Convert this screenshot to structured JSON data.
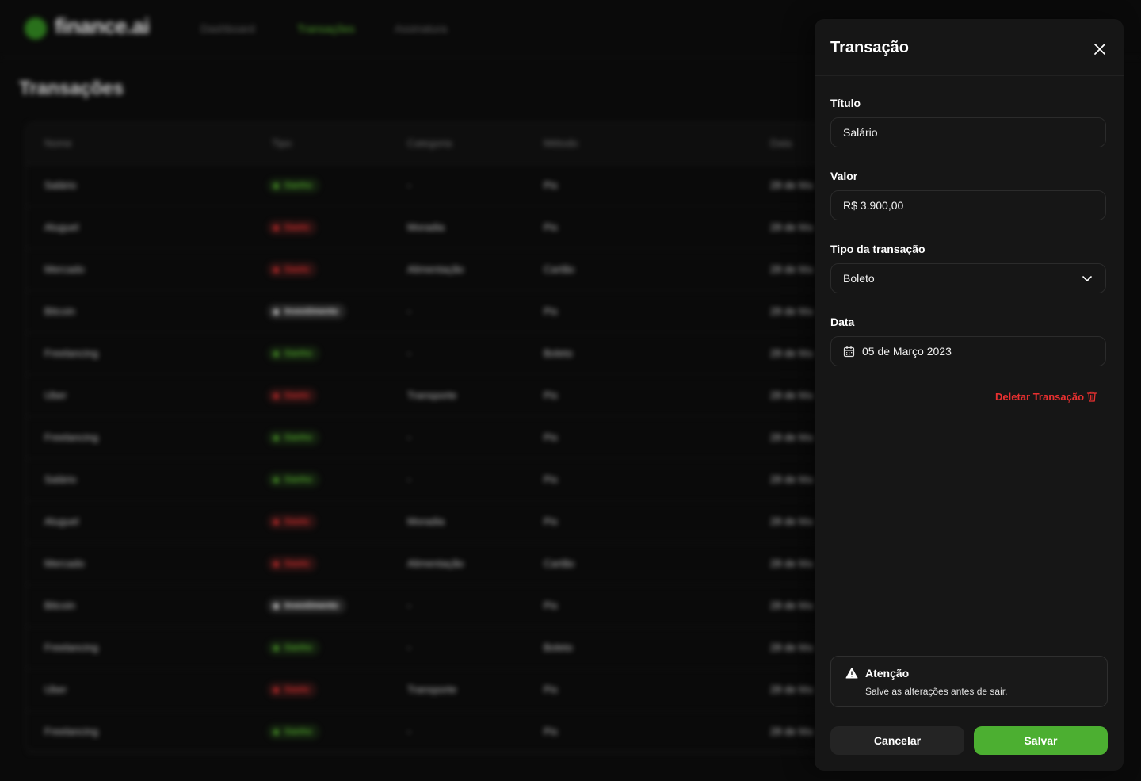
{
  "app": {
    "brand": "finance.ai",
    "nav": [
      {
        "label": "Dashboard",
        "active": false
      },
      {
        "label": "Transações",
        "active": true
      },
      {
        "label": "Assinatura",
        "active": false
      }
    ],
    "page_title": "Transações"
  },
  "table": {
    "columns": [
      "Nome",
      "Tipo",
      "Categoria",
      "Método",
      "Data"
    ],
    "rows": [
      {
        "name": "Salário",
        "type": "Ganho",
        "type_key": "ganho",
        "category": "-",
        "method": "Pix",
        "date": "28 de Ma"
      },
      {
        "name": "Aluguel",
        "type": "Gasto",
        "type_key": "gasto",
        "category": "Moradia",
        "method": "Pix",
        "date": "28 de Ma"
      },
      {
        "name": "Mercado",
        "type": "Gasto",
        "type_key": "gasto",
        "category": "Alimentação",
        "method": "Cartão",
        "date": "28 de Ma"
      },
      {
        "name": "Bitcoin",
        "type": "Investimento",
        "type_key": "investimento",
        "category": "-",
        "method": "Pix",
        "date": "28 de Ma"
      },
      {
        "name": "Freelancing",
        "type": "Ganho",
        "type_key": "ganho",
        "category": "-",
        "method": "Boleto",
        "date": "28 de Ma"
      },
      {
        "name": "Uber",
        "type": "Gasto",
        "type_key": "gasto",
        "category": "Transporte",
        "method": "Pix",
        "date": "28 de Ma"
      },
      {
        "name": "Freelancing",
        "type": "Ganho",
        "type_key": "ganho",
        "category": "-",
        "method": "Pix",
        "date": "28 de Ma"
      },
      {
        "name": "Salário",
        "type": "Ganho",
        "type_key": "ganho",
        "category": "-",
        "method": "Pix",
        "date": "28 de Ma"
      },
      {
        "name": "Aluguel",
        "type": "Gasto",
        "type_key": "gasto",
        "category": "Moradia",
        "method": "Pix",
        "date": "28 de Ma"
      },
      {
        "name": "Mercado",
        "type": "Gasto",
        "type_key": "gasto",
        "category": "Alimentação",
        "method": "Cartão",
        "date": "28 de Ma"
      },
      {
        "name": "Bitcoin",
        "type": "Investimento",
        "type_key": "investimento",
        "category": "-",
        "method": "Pix",
        "date": "28 de Ma"
      },
      {
        "name": "Freelancing",
        "type": "Ganho",
        "type_key": "ganho",
        "category": "-",
        "method": "Boleto",
        "date": "28 de Ma"
      },
      {
        "name": "Uber",
        "type": "Gasto",
        "type_key": "gasto",
        "category": "Transporte",
        "method": "Pix",
        "date": "28 de Ma"
      },
      {
        "name": "Freelancing",
        "type": "Ganho",
        "type_key": "ganho",
        "category": "-",
        "method": "Pix",
        "date": "28 de Ma"
      }
    ]
  },
  "dialog": {
    "title": "Transação",
    "close_icon": "close-icon",
    "fields": {
      "title": {
        "label": "Título",
        "value": "Salário"
      },
      "amount": {
        "label": "Valor",
        "value": "R$ 3.900,00"
      },
      "type": {
        "label": "Tipo da transação",
        "value": "Boleto"
      },
      "date": {
        "label": "Data",
        "value": "05 de Março 2023"
      }
    },
    "delete_label": "Deletar Transação",
    "alert": {
      "title": "Atenção",
      "description": "Salve as alterações antes de sair."
    },
    "buttons": {
      "cancel": "Cancelar",
      "save": "Salvar"
    }
  },
  "colors": {
    "accent_green": "#4caf31",
    "danger_red": "#e93030",
    "background": "#0a0a0a",
    "panel": "#161616"
  }
}
